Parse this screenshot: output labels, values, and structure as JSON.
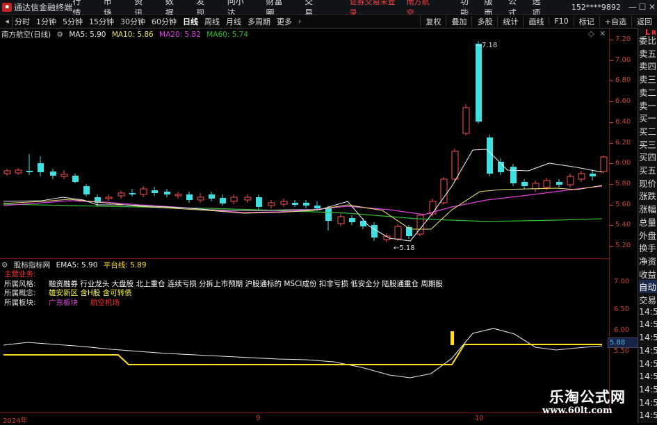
{
  "menubar": {
    "app_title": "通达信金融终端",
    "menus": [
      "行情",
      "市场",
      "资讯",
      "数据",
      "发现",
      "问小达",
      "财富圈",
      "交易"
    ],
    "login_status": "证券交易未登录",
    "stock_name": "南方航空",
    "right_items": [
      "功能",
      "版面",
      "公式",
      "选项"
    ],
    "user": "152****9892",
    "window_buttons": [
      "—",
      "☐",
      "✕"
    ]
  },
  "toolbar": {
    "periods": [
      "分时",
      "1分钟",
      "5分钟",
      "15分钟",
      "30分钟",
      "60分钟",
      "日线",
      "周线",
      "月线",
      "多周期",
      "更多"
    ],
    "active_period": "日线",
    "right_tools": [
      "复权",
      "叠加",
      "多股",
      "统计",
      "画线",
      "F10",
      "标记",
      "+自选",
      "返回"
    ]
  },
  "main_chart": {
    "title": "南方航空(日线)",
    "ma5_label": "MA5: 5.90",
    "ma10_label": "MA10: 5.86",
    "ma20_label": "MA20: 5.82",
    "ma60_label": "MA60: 5.74",
    "high_label": "7.18",
    "low_label": "5.18",
    "colors": {
      "ma5": "#e8e8e8",
      "ma10": "#e8e070",
      "ma20": "#e040e0",
      "ma60": "#30c030",
      "up": "#ff5050",
      "down": "#40e0e0"
    }
  },
  "price_axis": {
    "ticks": [
      "7.20",
      "7.00",
      "6.80",
      "6.60",
      "6.40",
      "6.20",
      "6.00",
      "5.80",
      "5.60",
      "5.40",
      "5.20"
    ]
  },
  "side_panel": {
    "lr_top": "L",
    "lr_bottom": "R",
    "lr_sub": "300",
    "labels": [
      "委比",
      "卖五",
      "卖四",
      "卖三",
      "卖二",
      "卖一",
      "买一",
      "买二",
      "买三",
      "买四",
      "买五",
      "现价",
      "涨跌",
      "涨幅",
      "总量",
      "外盘",
      "换手",
      "净资",
      "收益",
      "自动",
      "交易",
      "14:56",
      "14:56",
      "14:56",
      "14:56",
      "14:56",
      "14:56",
      "14:56",
      "14:56",
      "14:56"
    ]
  },
  "indicator": {
    "title": "股标指标网",
    "ema5_label": "EMA5: 5.90",
    "platform_label": "平台线: 5.89",
    "value_box": "5.88",
    "ticks": [
      "7.00",
      "6.50",
      "6.00",
      "5.50"
    ],
    "colors": {
      "ema": "#e8e8e8",
      "platform": "#ffe020",
      "marker": "#ffe020"
    }
  },
  "business": {
    "header": "主营业务:",
    "rows": [
      {
        "label": "所属风格:",
        "value": "融资融券 行业龙头 大盘股 北上重仓 连续亏损 分拆上市预期 沪股通标的 MSCI成份 扣非亏损 低安全分 陆股通重仓 周期股",
        "color": "#ffffff"
      },
      {
        "label": "所属概念:",
        "value": "雄安新区 含H股 含可转债",
        "color": "#ffff40"
      },
      {
        "label": "所属板块:",
        "value": "广东板块",
        "color": "#e040e0",
        "value2": "航空机场",
        "color2": "#ff3030"
      }
    ]
  },
  "date_axis": {
    "labels": [
      "2024年",
      "9",
      "10"
    ]
  },
  "watermark": {
    "title": "乐淘公式网",
    "url": "www.60lt.com"
  }
}
